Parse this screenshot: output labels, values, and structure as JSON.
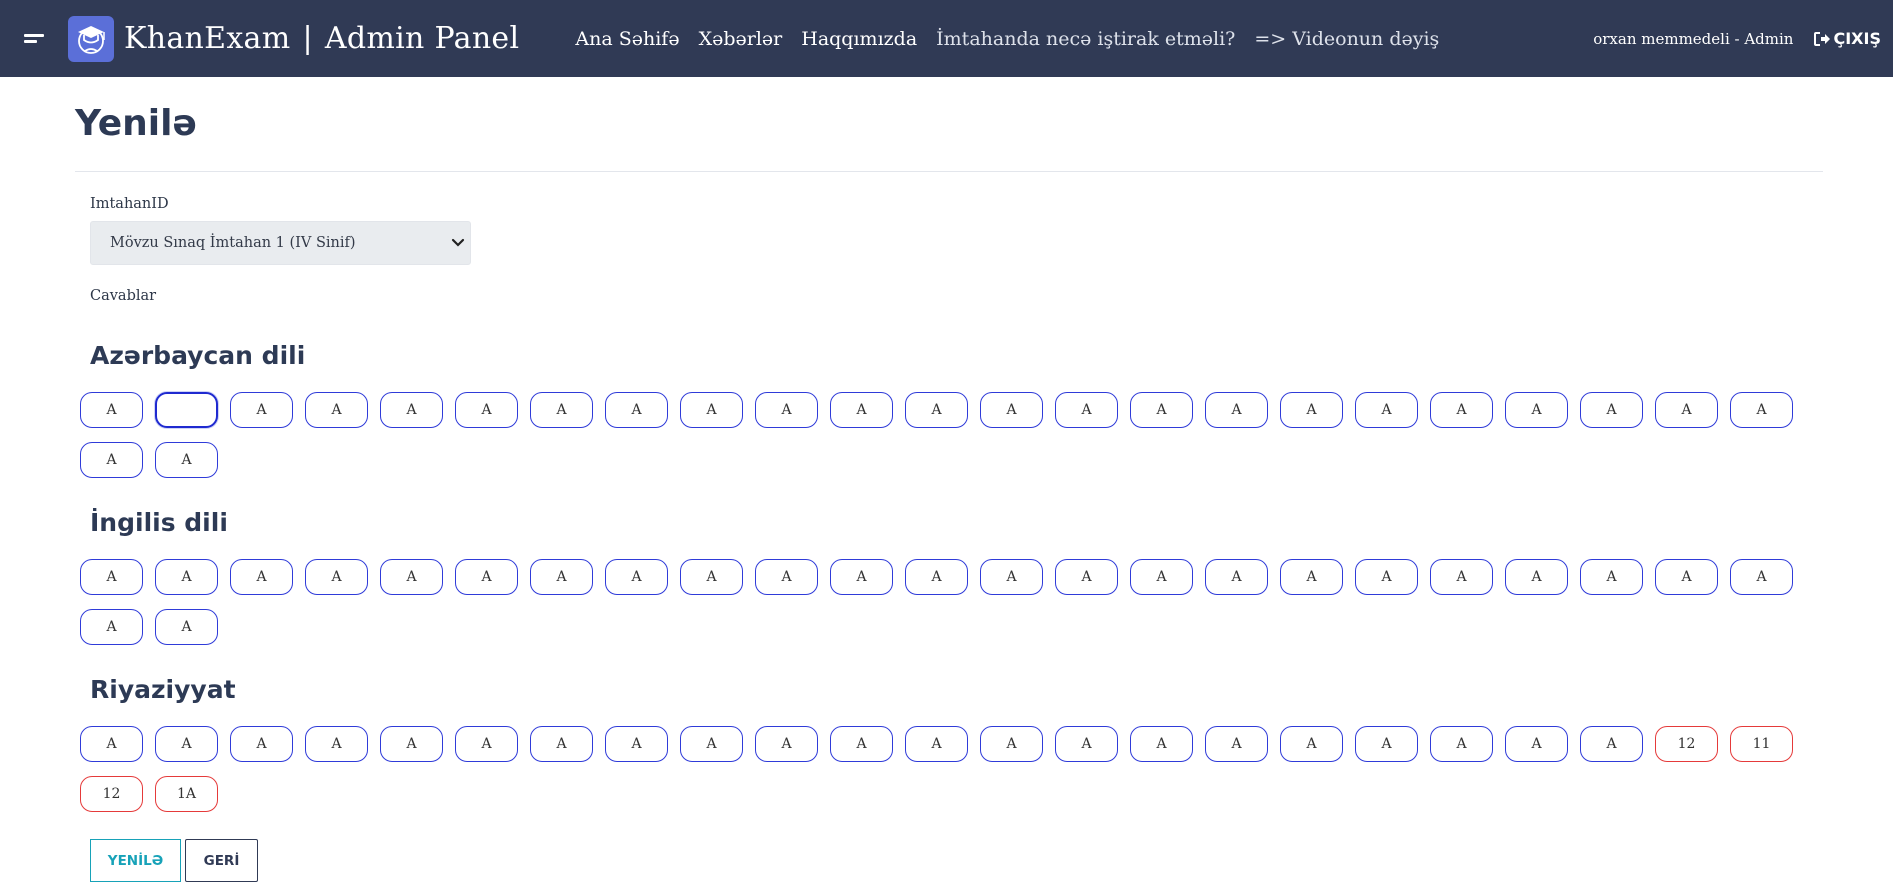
{
  "navbar": {
    "brand_name": "KhanExam",
    "brand_separator": "|",
    "brand_suffix": "Admin Panel",
    "links": [
      {
        "label": "Ana Səhifə"
      },
      {
        "label": "Xəbərlər"
      },
      {
        "label": "Haqqımızda"
      },
      {
        "label": "İmtahanda necə iştirak etməli?"
      },
      {
        "label": "=> Videonun dəyiş"
      }
    ],
    "user_label": "orxan memmedeli - Admin",
    "logout_label": "ÇIXIŞ"
  },
  "page": {
    "title": "Yenilə"
  },
  "form": {
    "exam_label": "ImtahanID",
    "exam_selected": "Mövzu Sınaq İmtahan 1 (IV Sinif)",
    "answers_label": "Cavablar"
  },
  "sections": {
    "az": {
      "title": "Azərbaycan dili",
      "answers": [
        "A",
        "",
        "A",
        "A",
        "A",
        "A",
        "A",
        "A",
        "A",
        "A",
        "A",
        "A",
        "A",
        "A",
        "A",
        "A",
        "A",
        "A",
        "A",
        "A",
        "A",
        "A",
        "A",
        "A",
        "A"
      ]
    },
    "en": {
      "title": "İngilis dili",
      "answers": [
        "A",
        "A",
        "A",
        "A",
        "A",
        "A",
        "A",
        "A",
        "A",
        "A",
        "A",
        "A",
        "A",
        "A",
        "A",
        "A",
        "A",
        "A",
        "A",
        "A",
        "A",
        "A",
        "A",
        "A",
        "A"
      ]
    },
    "math": {
      "title": "Riyaziyyat",
      "answers": [
        "A",
        "A",
        "A",
        "A",
        "A",
        "A",
        "A",
        "A",
        "A",
        "A",
        "A",
        "A",
        "A",
        "A",
        "A",
        "A",
        "A",
        "A",
        "A",
        "A",
        "A",
        "12",
        "11",
        "12",
        "1A"
      ]
    }
  },
  "buttons": {
    "update_label": "YENİLƏ",
    "back_label": "GERİ"
  },
  "colors": {
    "navbar_bg": "#303a55",
    "answer_border": "#2f3bd9",
    "invalid_border": "#e53a3a",
    "update_button": "#17a2b8"
  }
}
